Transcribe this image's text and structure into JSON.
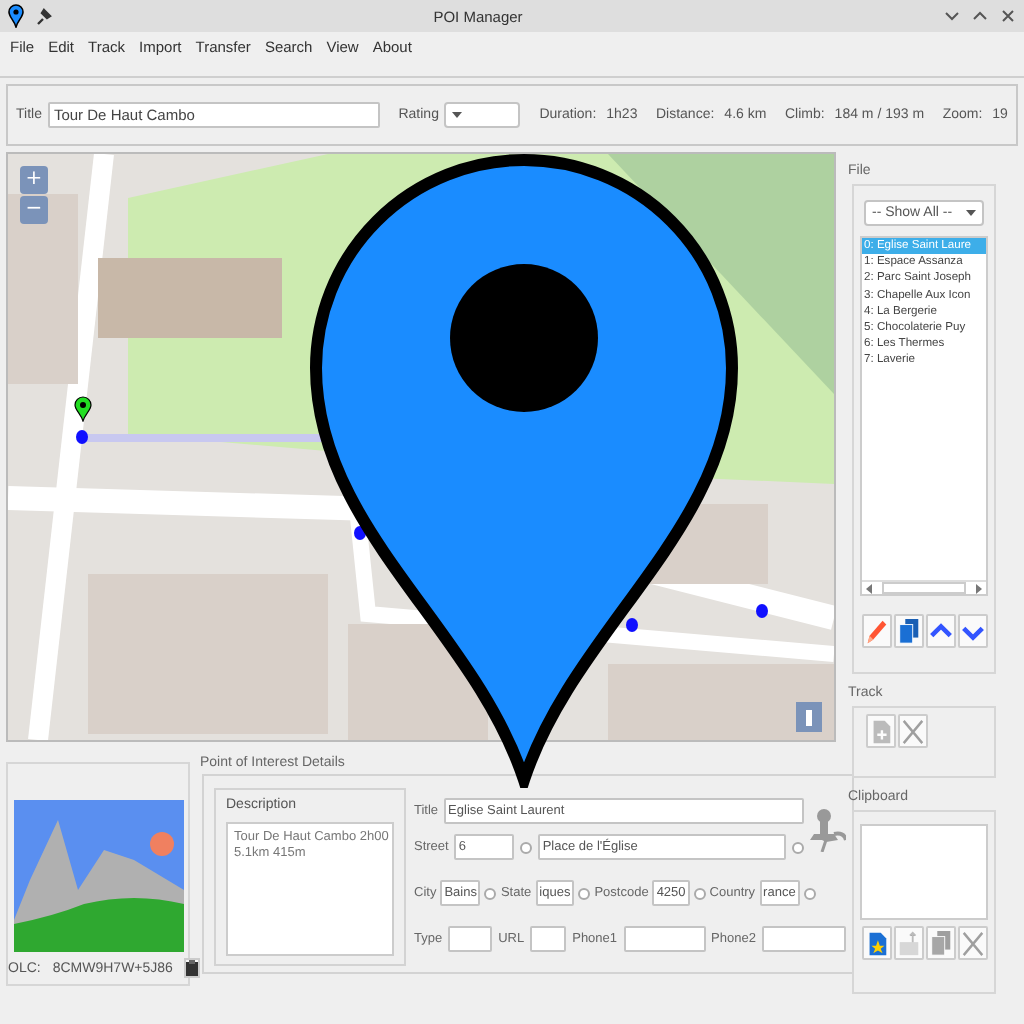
{
  "window": {
    "title": "POI Manager"
  },
  "menu": [
    {
      "label": "File"
    },
    {
      "label": "Edit"
    },
    {
      "label": "Track"
    },
    {
      "label": "Import"
    },
    {
      "label": "Transfer"
    },
    {
      "label": "Search"
    },
    {
      "label": "View"
    },
    {
      "label": "About"
    }
  ],
  "track_info": {
    "title_label": "Title",
    "title": "Tour De Haut Cambo",
    "rating_label": "Rating",
    "stats": [
      {
        "label": "Duration:",
        "value": "1h23"
      },
      {
        "label": "Distance:",
        "value": "4.6 km"
      },
      {
        "label": "Climb:",
        "value": "184 m / 193 m"
      },
      {
        "label": "Zoom:",
        "value": "19"
      }
    ]
  },
  "map": {
    "zoom_in": "+",
    "zoom_out": "−"
  },
  "file_panel": {
    "label": "File",
    "filter": "-- Show All --",
    "items": [
      {
        "text": "0: Eglise Saint Laure",
        "selected": true
      },
      {
        "text": "1: Espace Assanza",
        "selected": false
      },
      {
        "text": "2: Parc Saint Joseph",
        "selected": false
      },
      {
        "text": "3: Chapelle Aux Icon",
        "selected": false
      },
      {
        "text": "4: La Bergerie",
        "selected": false
      },
      {
        "text": "5: Chocolaterie Puy",
        "selected": false
      },
      {
        "text": "6: Les Thermes",
        "selected": false
      },
      {
        "text": "7: Laverie",
        "selected": false
      }
    ],
    "buttons": [
      {
        "kind": "edit",
        "disabled": false
      },
      {
        "kind": "copy",
        "disabled": false
      },
      {
        "kind": "up",
        "disabled": false
      },
      {
        "kind": "down",
        "disabled": false
      }
    ]
  },
  "track_panel": {
    "label": "Track",
    "buttons": [
      {
        "kind": "add",
        "disabled": true
      },
      {
        "kind": "delete",
        "disabled": true
      }
    ]
  },
  "clipboard_panel": {
    "label": "Clipboard",
    "buttons": [
      {
        "kind": "paste",
        "disabled": false
      },
      {
        "kind": "export",
        "disabled": true
      },
      {
        "kind": "copy",
        "disabled": true
      },
      {
        "kind": "delete",
        "disabled": true
      }
    ]
  },
  "photo": {
    "olc_label": "OLC:",
    "olc": "8CMW9H7W+5J86"
  },
  "details": {
    "label": "Point of Interest Details",
    "description_label": "Description",
    "description": "Tour De Haut Cambo 2h00\n5.1km 415m",
    "rows": [
      [
        {
          "label": "Title",
          "value": "Eglise Saint Laurent"
        }
      ],
      [
        {
          "label": "Street",
          "value": "6",
          "selected": false
        },
        {
          "value": "Place de l'Église",
          "selected": false
        }
      ],
      [
        {
          "label": "City",
          "value": "Bains",
          "selected": false
        },
        {
          "label": "State",
          "value": "iques",
          "selected": false
        },
        {
          "label": "Postcode",
          "value": "4250",
          "selected": false
        },
        {
          "label": "Country",
          "value": "rance",
          "selected": false
        }
      ],
      [
        {
          "label": "Type"
        },
        {
          "label": "URL"
        },
        {
          "label": "Phone1"
        },
        {
          "label": "Phone2"
        }
      ]
    ]
  }
}
